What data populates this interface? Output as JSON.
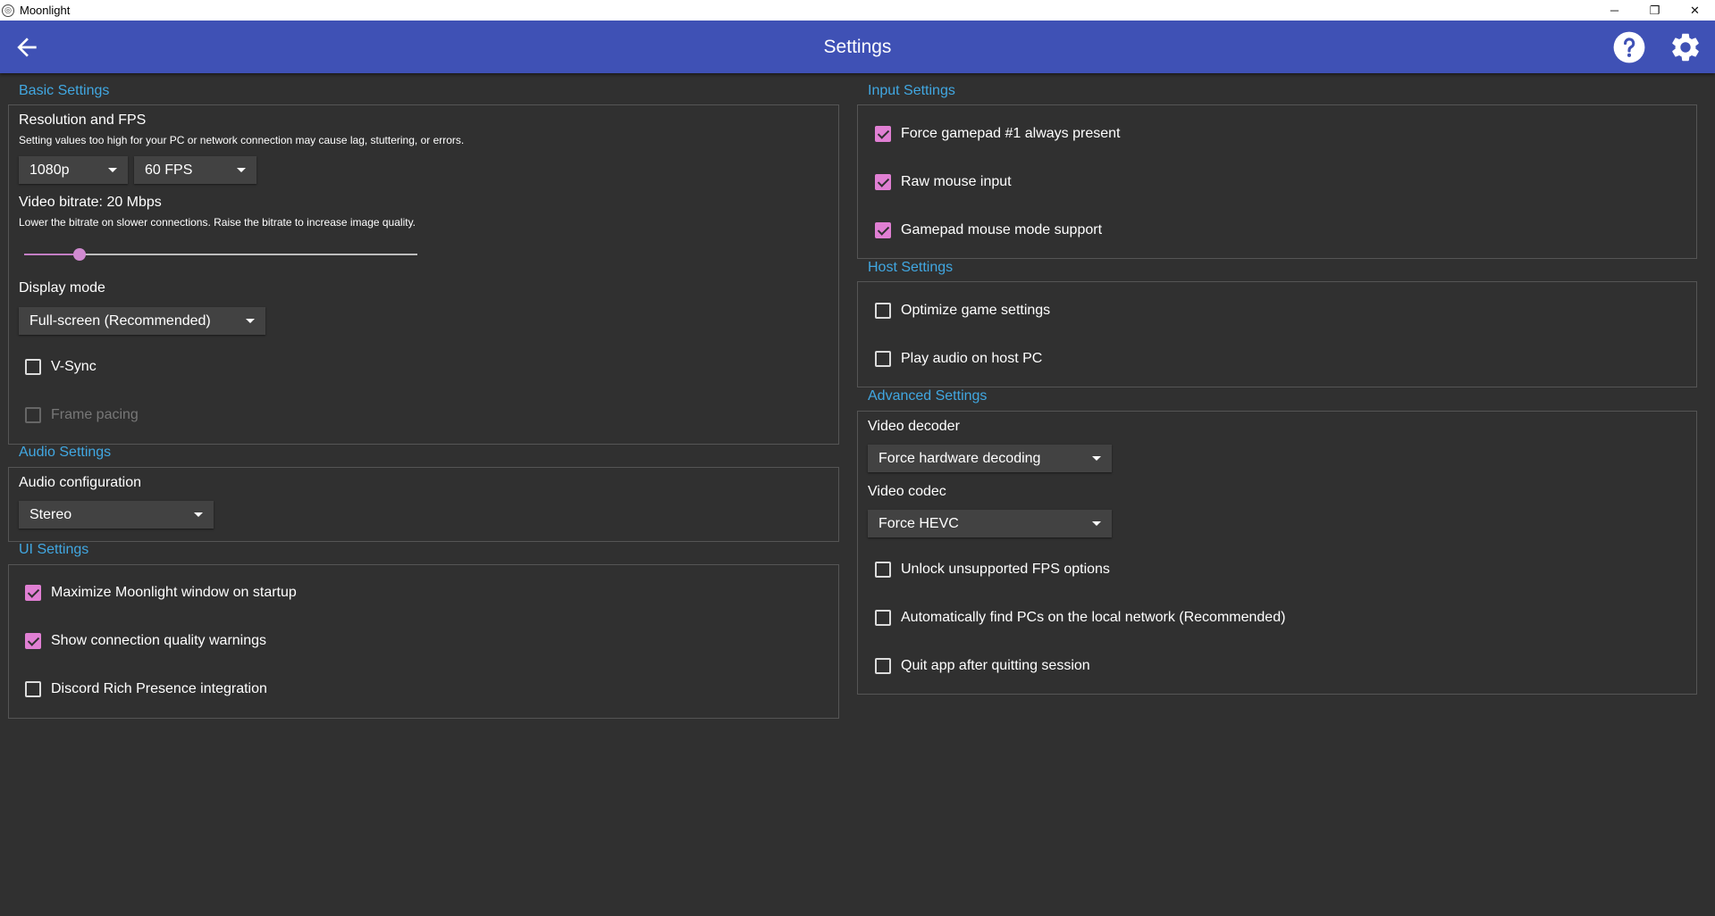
{
  "window": {
    "title": "Moonlight",
    "app_icon": "moonlight-icon",
    "minimize": "─",
    "restore": "❐",
    "close": "✕"
  },
  "header": {
    "title": "Settings",
    "back_icon": "arrow-left-icon",
    "help_icon": "help-circle-icon",
    "settings_icon": "gear-icon"
  },
  "colors": {
    "accent": "#3f51b5",
    "section_title": "#41a7e1",
    "check_on": "#e07fd3",
    "background": "#303030"
  },
  "basic": {
    "title": "Basic Settings",
    "resolution_label": "Resolution and FPS",
    "resolution_hint": "Setting values too high for your PC or network connection may cause lag, stuttering, or errors.",
    "resolution_value": "1080p",
    "fps_value": "60 FPS",
    "bitrate_label": "Video bitrate: 20 Mbps",
    "bitrate_hint": "Lower the bitrate on slower connections. Raise the bitrate to increase image quality.",
    "bitrate_level": 0.14,
    "display_mode_label": "Display mode",
    "display_mode_value": "Full-screen (Recommended)",
    "vsync": {
      "label": "V-Sync",
      "checked": false
    },
    "frame_pacing": {
      "label": "Frame pacing",
      "checked": false,
      "disabled": true
    }
  },
  "audio": {
    "title": "Audio Settings",
    "config_label": "Audio configuration",
    "config_value": "Stereo"
  },
  "ui": {
    "title": "UI Settings",
    "maximize": {
      "label": "Maximize Moonlight window on startup",
      "checked": true
    },
    "quality_warnings": {
      "label": "Show connection quality warnings",
      "checked": true
    },
    "discord": {
      "label": "Discord Rich Presence integration",
      "checked": false
    }
  },
  "input": {
    "title": "Input Settings",
    "gamepad_present": {
      "label": "Force gamepad #1 always present",
      "checked": true
    },
    "raw_mouse": {
      "label": "Raw mouse input",
      "checked": true
    },
    "gamepad_mouse": {
      "label": "Gamepad mouse mode support",
      "checked": true
    }
  },
  "host": {
    "title": "Host Settings",
    "optimize": {
      "label": "Optimize game settings",
      "checked": false
    },
    "audio_host": {
      "label": "Play audio on host PC",
      "checked": false
    }
  },
  "advanced": {
    "title": "Advanced Settings",
    "decoder_label": "Video decoder",
    "decoder_value": "Force hardware decoding",
    "codec_label": "Video codec",
    "codec_value": "Force HEVC",
    "unlock_fps": {
      "label": "Unlock unsupported FPS options",
      "checked": false
    },
    "auto_find": {
      "label": "Automatically find PCs on the local network (Recommended)",
      "checked": false
    },
    "quit_app": {
      "label": "Quit app after quitting session",
      "checked": false
    }
  }
}
